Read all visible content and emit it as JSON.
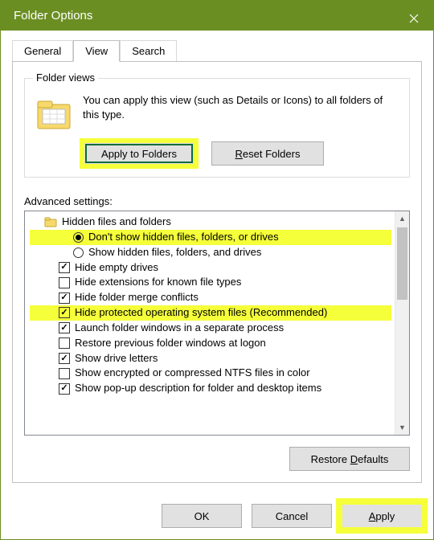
{
  "window": {
    "title": "Folder Options"
  },
  "tabs": {
    "general": "General",
    "view": "View",
    "search": "Search",
    "active": "view"
  },
  "folder_views": {
    "group_label": "Folder views",
    "description": "You can apply this view (such as Details or Icons) to all folders of this type.",
    "apply_btn": "Apply to Folders",
    "reset_btn": "Reset Folders"
  },
  "advanced": {
    "label": "Advanced settings:",
    "items": [
      {
        "kind": "folder",
        "indent": 0,
        "text": "Hidden files and folders",
        "highlight": false
      },
      {
        "kind": "radio",
        "indent": 2,
        "checked": true,
        "text": "Don't show hidden files, folders, or drives",
        "highlight": true
      },
      {
        "kind": "radio",
        "indent": 2,
        "checked": false,
        "text": "Show hidden files, folders, and drives",
        "highlight": false
      },
      {
        "kind": "check",
        "indent": 1,
        "checked": true,
        "text": "Hide empty drives",
        "highlight": false
      },
      {
        "kind": "check",
        "indent": 1,
        "checked": false,
        "text": "Hide extensions for known file types",
        "highlight": false
      },
      {
        "kind": "check",
        "indent": 1,
        "checked": true,
        "text": "Hide folder merge conflicts",
        "highlight": false
      },
      {
        "kind": "check",
        "indent": 1,
        "checked": true,
        "text": "Hide protected operating system files (Recommended)",
        "highlight": true
      },
      {
        "kind": "check",
        "indent": 1,
        "checked": true,
        "text": "Launch folder windows in a separate process",
        "highlight": false
      },
      {
        "kind": "check",
        "indent": 1,
        "checked": false,
        "text": "Restore previous folder windows at logon",
        "highlight": false
      },
      {
        "kind": "check",
        "indent": 1,
        "checked": true,
        "text": "Show drive letters",
        "highlight": false
      },
      {
        "kind": "check",
        "indent": 1,
        "checked": false,
        "text": "Show encrypted or compressed NTFS files in color",
        "highlight": false
      },
      {
        "kind": "check",
        "indent": 1,
        "checked": true,
        "text": "Show pop-up description for folder and desktop items",
        "highlight": false
      }
    ],
    "restore_btn": "Restore Defaults"
  },
  "bottom": {
    "ok": "OK",
    "cancel": "Cancel",
    "apply": "Apply"
  }
}
